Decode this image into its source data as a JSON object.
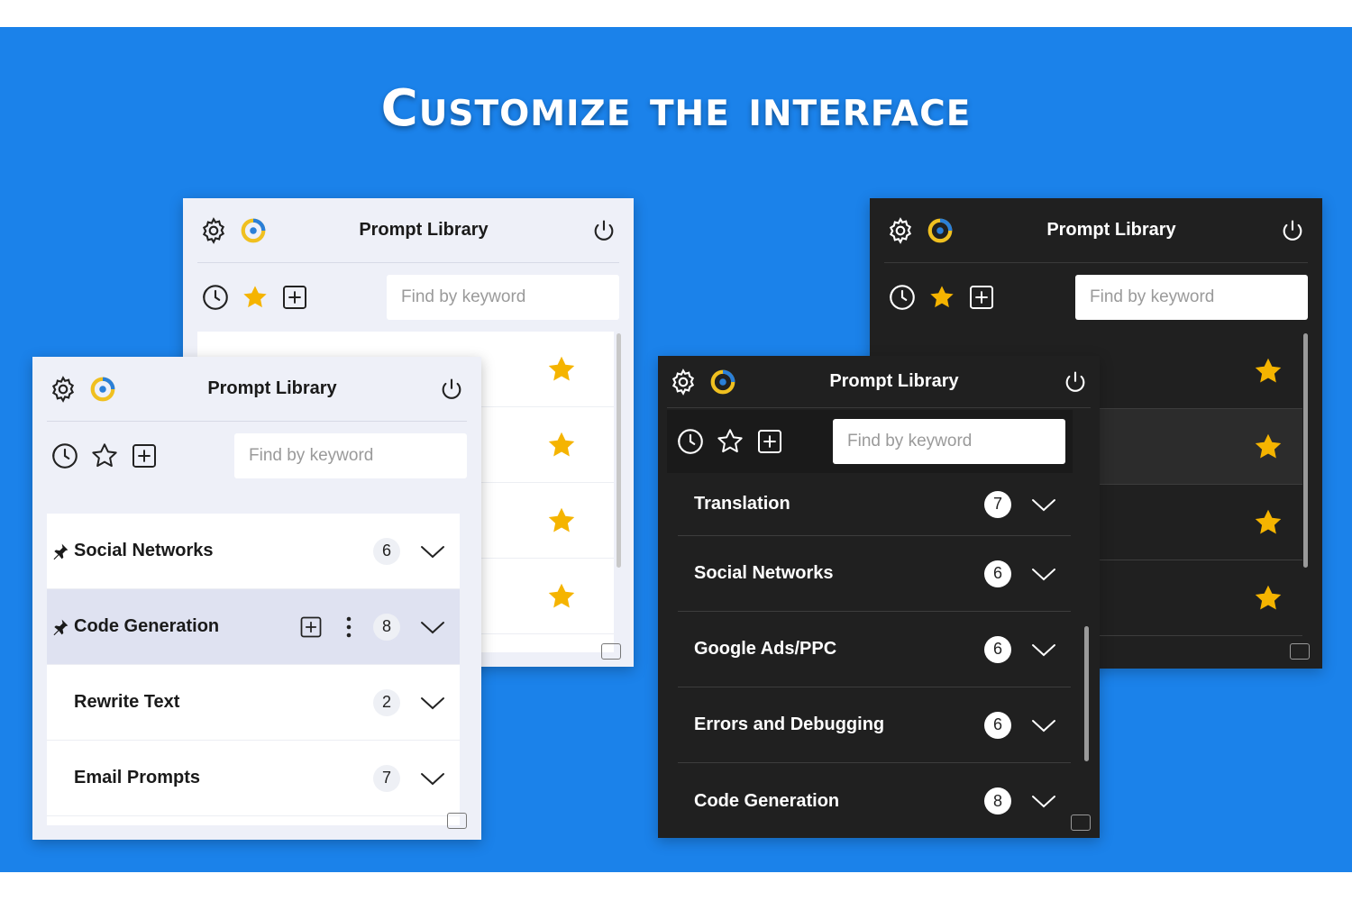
{
  "headline": "Customize the interface",
  "common": {
    "title": "Prompt Library",
    "search_placeholder": "Find by keyword"
  },
  "light_back": {
    "star_color": "#f5b400"
  },
  "light_front": {
    "rows": [
      {
        "name": "Social Networks",
        "count": "6"
      },
      {
        "name": "Code Generation",
        "count": "8"
      },
      {
        "name": "Rewrite Text",
        "count": "2"
      },
      {
        "name": "Email Prompts",
        "count": "7"
      }
    ]
  },
  "dark_front": {
    "rows": [
      {
        "name": "Translation",
        "count": "7"
      },
      {
        "name": "Social Networks",
        "count": "6"
      },
      {
        "name": "Google Ads/PPC",
        "count": "6"
      },
      {
        "name": "Errors and Debugging",
        "count": "6"
      },
      {
        "name": "Code Generation",
        "count": "8"
      }
    ]
  },
  "colors": {
    "banner": "#1b82ea",
    "star": "#f5b400",
    "logo_blue": "#2a7fd8",
    "logo_yellow": "#f0c020"
  }
}
